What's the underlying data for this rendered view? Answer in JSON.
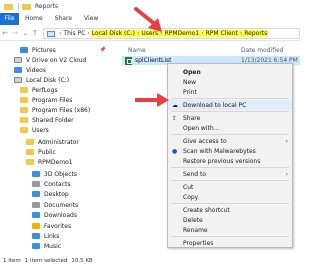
{
  "window": {
    "title": "Reports"
  },
  "ribbon": {
    "tabs": [
      "File",
      "Home",
      "Share",
      "View"
    ]
  },
  "address": {
    "breadcrumbs": [
      "This PC",
      "Local Disk (C:)",
      "Users",
      "RPMDemo1",
      "RPM Client",
      "Reports"
    ]
  },
  "sidebar": {
    "items": [
      {
        "label": "Pictures",
        "pinned": true
      },
      {
        "label": "V Drive on V2 Cloud"
      },
      {
        "label": "Videos"
      },
      {
        "label": "Local Disk (C:)"
      },
      {
        "label": "PerfLogs"
      },
      {
        "label": "Program Files"
      },
      {
        "label": "Program Files (x86)"
      },
      {
        "label": "Shared Folder"
      },
      {
        "label": "Users"
      },
      {
        "label": "Administrator"
      },
      {
        "label": "Public"
      },
      {
        "label": "RPMDemo1"
      },
      {
        "label": "3D Objects"
      },
      {
        "label": "Contacts"
      },
      {
        "label": "Desktop"
      },
      {
        "label": "Documents"
      },
      {
        "label": "Downloads"
      },
      {
        "label": "Favorites"
      },
      {
        "label": "Links"
      },
      {
        "label": "Music"
      }
    ]
  },
  "filelist": {
    "col_name": "Name",
    "col_date": "Date modified",
    "file": {
      "name": "splClientList",
      "date": "1/13/2021 6:54 PM"
    }
  },
  "context_menu": {
    "items": [
      "Open",
      "New",
      "Print",
      "Download to local PC",
      "Share",
      "Open with...",
      "Give access to",
      "Scan with Malwarebytes",
      "Restore previous versions",
      "Send to",
      "Cut",
      "Copy",
      "Create shortcut",
      "Delete",
      "Rename",
      "Properties"
    ]
  },
  "status": {
    "count": "1 item",
    "selected": "1 item selected",
    "size": "10.5 KB"
  },
  "colors": {
    "highlight": "#ffff40",
    "accent": "#1a6fd6",
    "arrow": "#e84040"
  }
}
